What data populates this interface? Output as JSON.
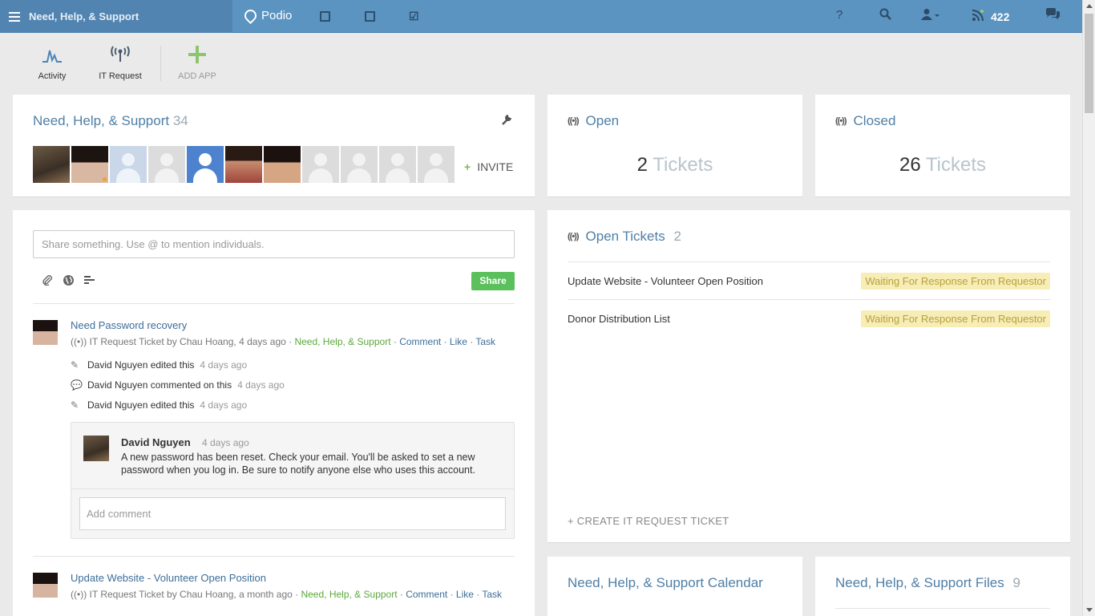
{
  "topbar": {
    "workspace_name": "Need, Help, & Support",
    "brand": "Podio",
    "notification_count": "422",
    "help_glyph": "?",
    "icons": [
      "menu-icon",
      "contacts-icon",
      "calendar-icon",
      "tasks-icon",
      "help-icon",
      "search-icon",
      "user-menu-icon",
      "notifications-icon",
      "chat-icon"
    ]
  },
  "apps": [
    {
      "label": "Activity",
      "icon": "activity-icon"
    },
    {
      "label": "IT Request",
      "icon": "antenna-icon"
    },
    {
      "label": "ADD APP",
      "icon": "plus-icon"
    }
  ],
  "workspace": {
    "title": "Need, Help, & Support",
    "member_count": "34",
    "invite_label": "INVITE"
  },
  "stats": {
    "open": {
      "title": "Open",
      "count": "2",
      "label": "Tickets"
    },
    "closed": {
      "title": "Closed",
      "count": "26",
      "label": "Tickets"
    }
  },
  "stream": {
    "share_placeholder": "Share something. Use @ to mention individuals.",
    "share_button": "Share",
    "posts": [
      {
        "title": "Need Password recovery",
        "meta_prefix": "IT Request Ticket by Chau Hoang, 4 days ago · ",
        "workspace_link": "Need, Help, & Support",
        "actions": [
          "Comment",
          "Like",
          "Task"
        ],
        "activity": [
          {
            "text": "David Nguyen edited this",
            "time": "4 days ago"
          },
          {
            "text": "David Nguyen commented on this",
            "time": "4 days ago"
          },
          {
            "text": "David Nguyen edited this",
            "time": "4 days ago"
          }
        ],
        "comment": {
          "author": "David Nguyen",
          "time": "4 days ago",
          "text": "A new password has been reset. Check your email. You'll be asked to set a new password when you log in. Be sure to notify anyone else who uses this account.",
          "add_placeholder": "Add comment"
        }
      },
      {
        "title": "Update Website - Volunteer Open Position",
        "meta_prefix": "IT Request Ticket by Chau Hoang, a month ago · ",
        "workspace_link": "Need, Help, & Support",
        "actions": [
          "Comment",
          "Like",
          "Task"
        ]
      }
    ]
  },
  "open_tickets": {
    "title": "Open Tickets",
    "count": "2",
    "items": [
      {
        "name": "Update Website - Volunteer Open Position",
        "status": "Waiting For Response From Requestor"
      },
      {
        "name": "Donor Distribution List",
        "status": "Waiting For Response From Requestor"
      }
    ],
    "create_label": "+ CREATE IT REQUEST TICKET"
  },
  "calendar": {
    "title": "Need, Help, & Support Calendar"
  },
  "files": {
    "title": "Need, Help, & Support Files",
    "count": "9"
  }
}
